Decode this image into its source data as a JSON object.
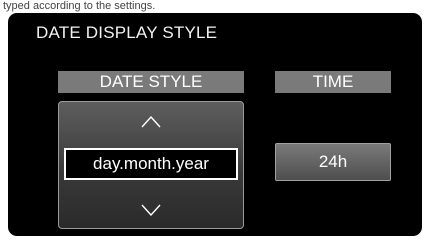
{
  "caption": "typed according to the settings.",
  "screen_title": "DATE DISPLAY STYLE",
  "date_style": {
    "header": "DATE STYLE",
    "value": "day.month.year",
    "up_icon": "chevron-up-icon",
    "down_icon": "chevron-down-icon"
  },
  "time": {
    "header": "TIME",
    "value": "24h"
  },
  "colors": {
    "background": "#000000",
    "header_bar": "#7a7a7a",
    "text": "#ffffff"
  }
}
